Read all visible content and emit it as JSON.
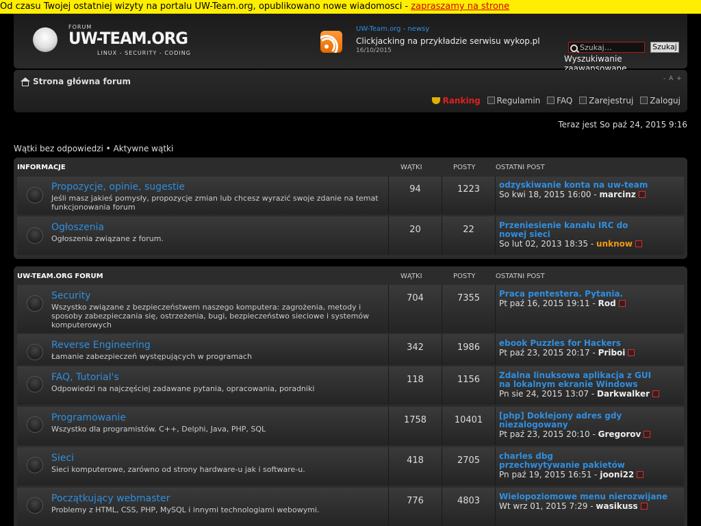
{
  "notice": {
    "text": "Od czasu Twojej ostatniej wizyty na portalu UW-Team.org, opublikowano nowe wiadomosci - ",
    "link": "zapraszamy na strone"
  },
  "logo": {
    "forum": "FORUM",
    "name": "UW-TEAM.ORG",
    "sub": "LINUX - SECURITY - CODING"
  },
  "news": {
    "source": "UW-Team.org - newsy",
    "title": "Clickjacking na przykładzie serwisu wykop.pl",
    "date": "16/10/2015"
  },
  "search": {
    "placeholder": "Szukaj…",
    "button": "Szukaj",
    "advanced": "Wyszukiwanie zaawansowane"
  },
  "nav": {
    "breadcrumb": "Strona główna forum",
    "font_size": "- A +",
    "links": {
      "ranking": "Ranking",
      "rules": "Regulamin",
      "faq": "FAQ",
      "register": "Zarejestruj",
      "login": "Zaloguj"
    }
  },
  "current_time": "Teraz jest So paź 24, 2015 9:16",
  "quick_links": {
    "unanswered": "Wątki bez odpowiedzi",
    "sep": " • ",
    "active": "Aktywne wątki"
  },
  "columns": {
    "topics": "WĄTKI",
    "posts": "POSTY",
    "last": "OSTATNI POST"
  },
  "categories": [
    {
      "name": "INFORMACJE",
      "forums": [
        {
          "title": "Propozycje, opinie, sugestie",
          "desc": "Jeśli masz jakieś pomysły, propozycje zmian lub chcesz wyrazić swoje zdanie na temat funkcjonowania forum",
          "topics": "94",
          "posts": "1223",
          "last_title": "odzyskiwanie konta na uw-team",
          "last_date": "So kwi 18, 2015 16:00 - ",
          "last_user": "marcinz"
        },
        {
          "title": "Ogłoszenia",
          "desc": "Ogłoszenia związane z forum.",
          "topics": "20",
          "posts": "22",
          "last_title": "Przeniesienie kanału IRC do nowej sieci",
          "last_date": "So lut 02, 2013 18:35 - ",
          "last_user": "unknow"
        }
      ]
    },
    {
      "name": "UW-TEAM.ORG FORUM",
      "forums": [
        {
          "title": "Security",
          "desc": "Wszystko związane z bezpieczeństwem naszego komputera: zagrożenia, metody i sposoby zabezpieczania się, ostrzeżenia, bugi, bezpieczeństwo sieciowe i systemów komputerowych",
          "topics": "704",
          "posts": "7355",
          "last_title": "Praca pentestera. Pytania.",
          "last_date": "Pt paź 16, 2015 19:11 - ",
          "last_user": "Rod"
        },
        {
          "title": "Reverse Engineering",
          "desc": "Łamanie zabezpieczeń występujących w programach",
          "topics": "342",
          "posts": "1986",
          "last_title": "ebook Puzzles for Hackers",
          "last_date": "Pt paź 23, 2015 20:17 - ",
          "last_user": "Priboi"
        },
        {
          "title": "FAQ, Tutorial's",
          "desc": "Odpowiedzi na najczęściej zadawane pytania, opracowania, poradniki",
          "topics": "118",
          "posts": "1156",
          "last_title": "Zdalna linuksowa aplikacja z GUI na lokalnym ekranie Windows",
          "last_date": "Pn sie 24, 2015 13:07 - ",
          "last_user": "Darkwalker"
        },
        {
          "title": "Programowanie",
          "desc": "Wszystko dla programistów. C++, Delphi, Java, PHP, SQL",
          "topics": "1758",
          "posts": "10401",
          "last_title": "[php] Doklejony adres gdy niezalogowany",
          "last_date": "Pt paź 23, 2015 20:10 - ",
          "last_user": "Gregorov"
        },
        {
          "title": "Sieci",
          "desc": "Sieci komputerowe, zarówno od strony hardware-u jak i software-u.",
          "topics": "418",
          "posts": "2705",
          "last_title": "charles dbg przechwytywanie pakietów",
          "last_date": "Pn paź 19, 2015 16:51 - ",
          "last_user": "jooni22"
        },
        {
          "title": "Początkujący webmaster",
          "desc": "Problemy z HTML, CSS, PHP, MySQL i innymi technologiami webowymi.",
          "topics": "776",
          "posts": "4803",
          "last_title": "Wielopoziomowe menu nierozwijane",
          "last_date": "Wt wrz 01, 2015 7:29 - ",
          "last_user": "wasikuss"
        }
      ]
    }
  ]
}
